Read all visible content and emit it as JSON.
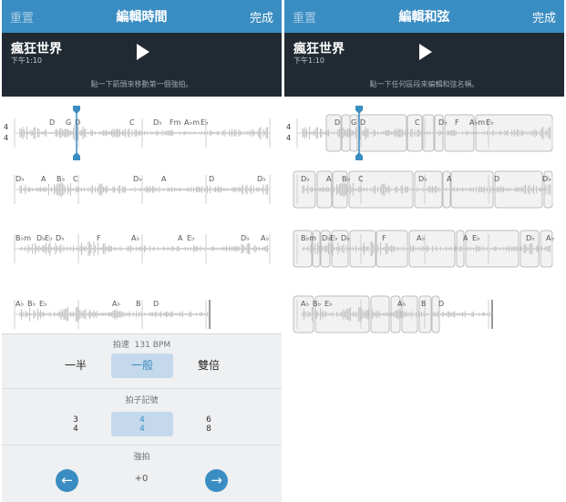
{
  "left": {
    "nav": {
      "reset": "重置",
      "title": "編輯時間",
      "done": "完成"
    },
    "song": {
      "title": "瘋狂世界",
      "time": "下午1:10"
    },
    "hint": "點一下箭頭來移動第一個強拍。",
    "time_signature_marker": {
      "top": "4",
      "bottom": "4"
    },
    "rows": [
      {
        "chords": [
          "D",
          "G",
          "D",
          "C",
          "D♭",
          "Fm",
          "A♭m",
          "E♭"
        ]
      },
      {
        "chords": [
          "D♭",
          "A",
          "B♭",
          "C",
          "D♭",
          "A",
          "D",
          "D♭"
        ]
      },
      {
        "chords": [
          "B♭m",
          "D♭",
          "E♭",
          "D♭",
          "F",
          "A♭",
          "A",
          "E♭",
          "D♭",
          "A♭"
        ]
      },
      {
        "chords": [
          "A♭",
          "B♭",
          "E♭",
          "A♭",
          "B",
          "D"
        ]
      }
    ],
    "sheet": {
      "tempo_label": "拍速",
      "tempo_value": "131 BPM",
      "speed_options": [
        "一半",
        "一般",
        "雙倍"
      ],
      "speed_selected": 1,
      "meter_label": "拍子記號",
      "meters": [
        {
          "top": "3",
          "bottom": "4"
        },
        {
          "top": "4",
          "bottom": "4"
        },
        {
          "top": "6",
          "bottom": "8"
        }
      ],
      "meter_selected": 1,
      "downbeat_label": "強拍",
      "downbeat_offset": "+0",
      "prev_icon": "arrow-left-icon",
      "next_icon": "arrow-right-icon"
    }
  },
  "right": {
    "nav": {
      "reset": "重置",
      "title": "編輯和弦",
      "done": "完成"
    },
    "song": {
      "title": "瘋狂世界",
      "time": "下午1:10"
    },
    "hint": "點一下任何區段來編輯和弦名稱。",
    "time_signature_marker": {
      "top": "4",
      "bottom": "4"
    },
    "rows": [
      {
        "chords": [
          "D",
          "G",
          "D",
          "C",
          "D♭",
          "F",
          "A♭m",
          "E♭"
        ]
      },
      {
        "chords": [
          "D♭",
          "A",
          "B♭",
          "C",
          "D♭",
          "A",
          "D",
          "D♭"
        ]
      },
      {
        "chords": [
          "B♭m",
          "D♭",
          "E♭",
          "D♭",
          "F",
          "A♭",
          "A",
          "E♭",
          "D♭",
          "A♭"
        ]
      },
      {
        "chords": [
          "A♭",
          "B♭",
          "E♭",
          "A♭",
          "B",
          "D"
        ]
      }
    ]
  },
  "colors": {
    "accent": "#3a8dc2",
    "transport_bg": "#212a33",
    "waveform": "#c4c4c4",
    "selection": "#c4d9eb"
  }
}
